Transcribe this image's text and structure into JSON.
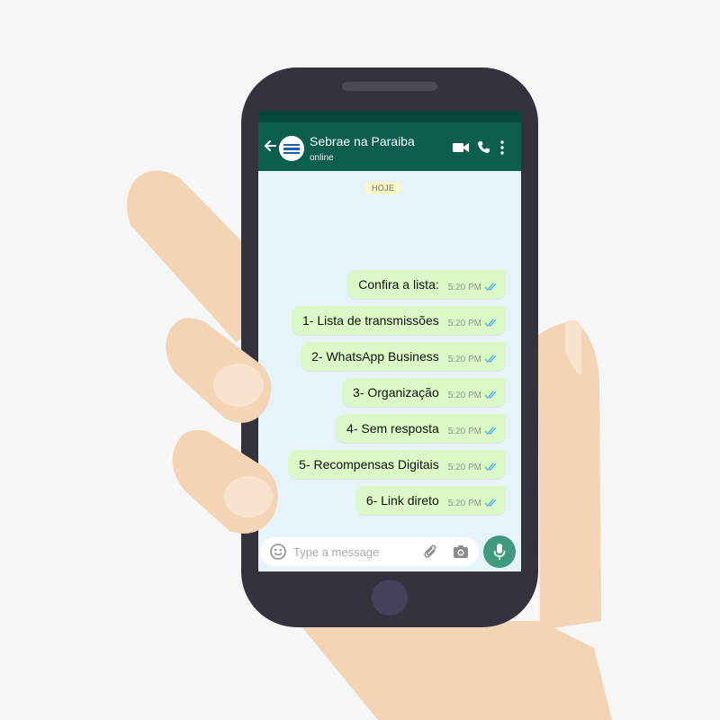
{
  "chat": {
    "contact_name": "Sebrae na Paraiba",
    "status": "online",
    "date_label": "HOJE"
  },
  "icons": {
    "back": "arrow-left-icon",
    "avatar": "sebrae-logo",
    "video": "video-call-icon",
    "call": "phone-icon",
    "menu": "more-vertical-icon",
    "emoji": "emoji-icon",
    "attach": "paperclip-icon",
    "camera": "camera-icon",
    "mic": "microphone-icon"
  },
  "messages": [
    {
      "text": "Confira a lista:",
      "time": "5:20 PM"
    },
    {
      "text": "1- Lista de transmissões",
      "time": "5:20 PM"
    },
    {
      "text": "2- WhatsApp Business",
      "time": "5:20 PM"
    },
    {
      "text": "3- Organização",
      "time": "5:20 PM"
    },
    {
      "text": "4- Sem resposta",
      "time": "5:20 PM"
    },
    {
      "text": "5- Recompensas Digitais",
      "time": "5:20 PM"
    },
    {
      "text": "6- Link direto",
      "time": "5:20 PM"
    }
  ],
  "composer": {
    "placeholder": "Type a message"
  },
  "colors": {
    "header": "#0c5e4e",
    "status_bar": "#07473b",
    "bubble": "#dcf8c6",
    "chat_background": "#e6f3fb",
    "read_ticks": "#4fb6ec",
    "mic_button": "#3f9a80",
    "phone_body": "#33323d",
    "skin": "#f3d4b4"
  }
}
